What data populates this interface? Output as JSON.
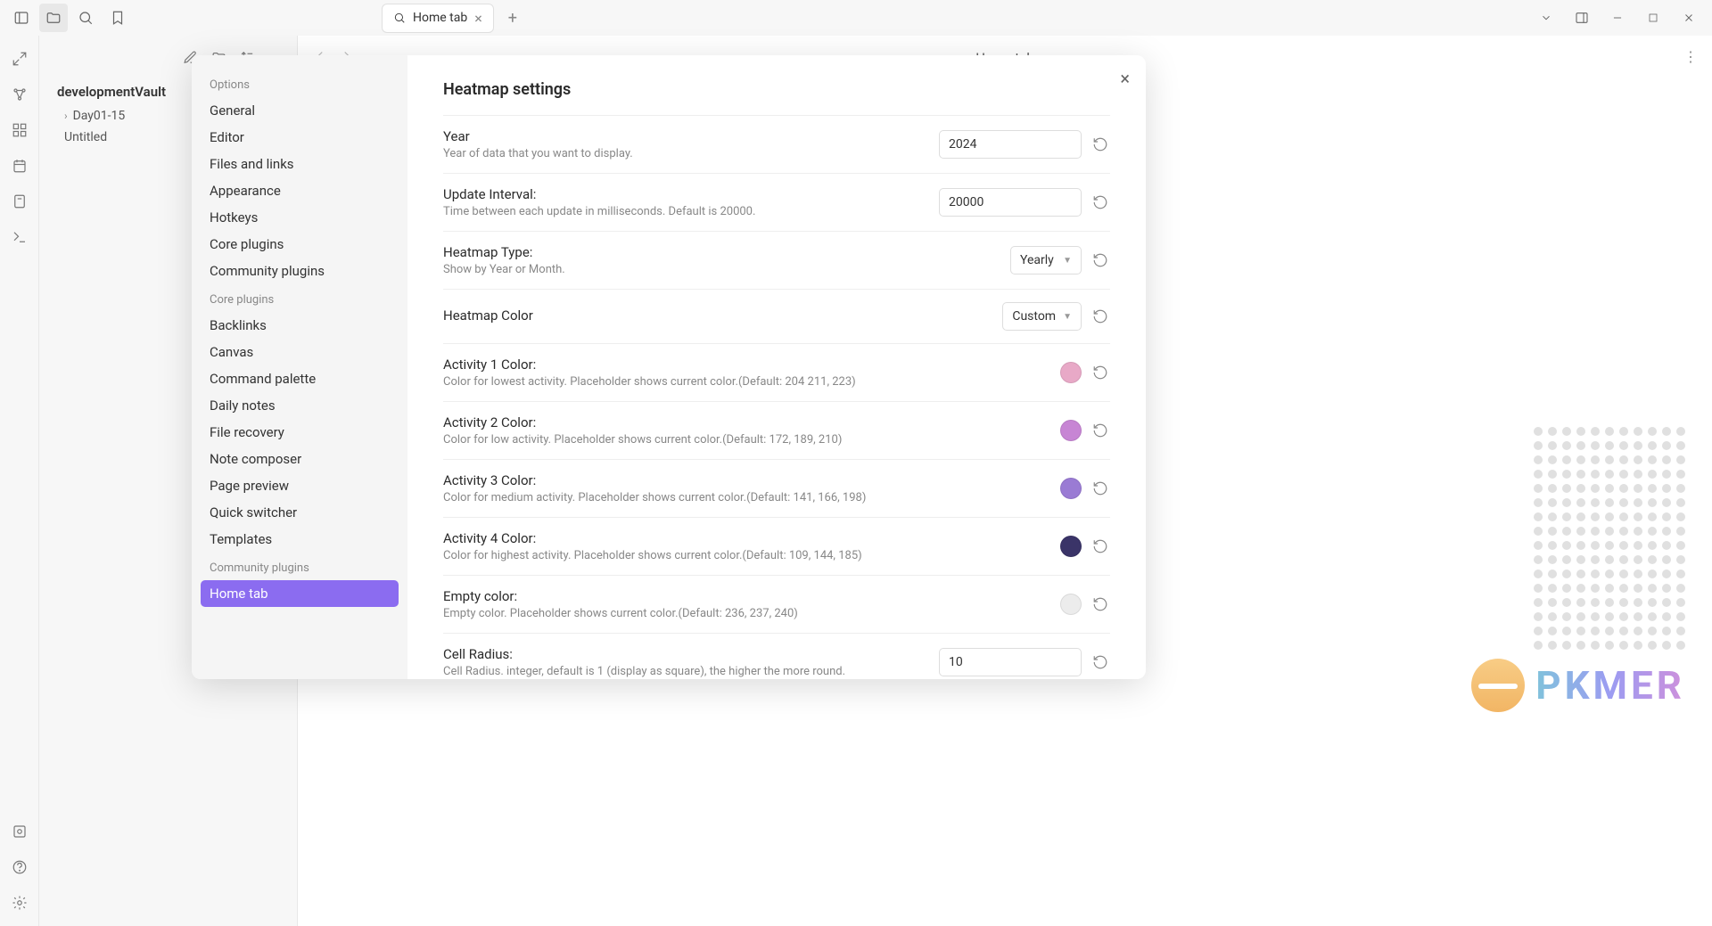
{
  "titlebar": {
    "tab_label": "Home tab"
  },
  "content": {
    "header_title": "Home tab"
  },
  "explorer": {
    "vault_name": "developmentVault",
    "folder1": "Day01-15",
    "file1": "Untitled"
  },
  "settings_sidebar": {
    "options_header": "Options",
    "options": [
      "General",
      "Editor",
      "Files and links",
      "Appearance",
      "Hotkeys",
      "Core plugins",
      "Community plugins"
    ],
    "core_header": "Core plugins",
    "core": [
      "Backlinks",
      "Canvas",
      "Command palette",
      "Daily notes",
      "File recovery",
      "Note composer",
      "Page preview",
      "Quick switcher",
      "Templates"
    ],
    "community_header": "Community plugins",
    "community": [
      "Home tab"
    ]
  },
  "modal": {
    "title": "Heatmap settings",
    "rows": {
      "year": {
        "label": "Year",
        "desc": "Year of data that you want to display.",
        "value": "2024"
      },
      "interval": {
        "label": "Update Interval:",
        "desc": "Time between each update in milliseconds. Default is 20000.",
        "value": "20000"
      },
      "type": {
        "label": "Heatmap Type:",
        "desc": "Show by Year or Month.",
        "value": "Yearly"
      },
      "color": {
        "label": "Heatmap Color",
        "desc": "",
        "value": "Custom"
      },
      "a1": {
        "label": "Activity 1 Color:",
        "desc": "Color for lowest activity. Placeholder shows current color.(Default: 204 211, 223)",
        "swatch": "#e8a9c7"
      },
      "a2": {
        "label": "Activity 2 Color:",
        "desc": "Color for low activity. Placeholder shows current color.(Default: 172, 189, 210)",
        "swatch": "#c785d4"
      },
      "a3": {
        "label": "Activity 3 Color:",
        "desc": "Color for medium activity. Placeholder shows current color.(Default: 141, 166, 198)",
        "swatch": "#9a7bd4"
      },
      "a4": {
        "label": "Activity 4 Color:",
        "desc": "Color for highest activity. Placeholder shows current color.(Default: 109, 144, 185)",
        "swatch": "#3a3468"
      },
      "empty": {
        "label": "Empty color:",
        "desc": "Empty color. Placeholder shows current color.(Default: 236, 237, 240)",
        "swatch": "#ececec"
      },
      "radius": {
        "label": "Cell Radius:",
        "desc": "Cell Radius. integer, default is 1 (display as square), the higher the more round.",
        "value": "10"
      }
    }
  },
  "watermark": "PKMER"
}
